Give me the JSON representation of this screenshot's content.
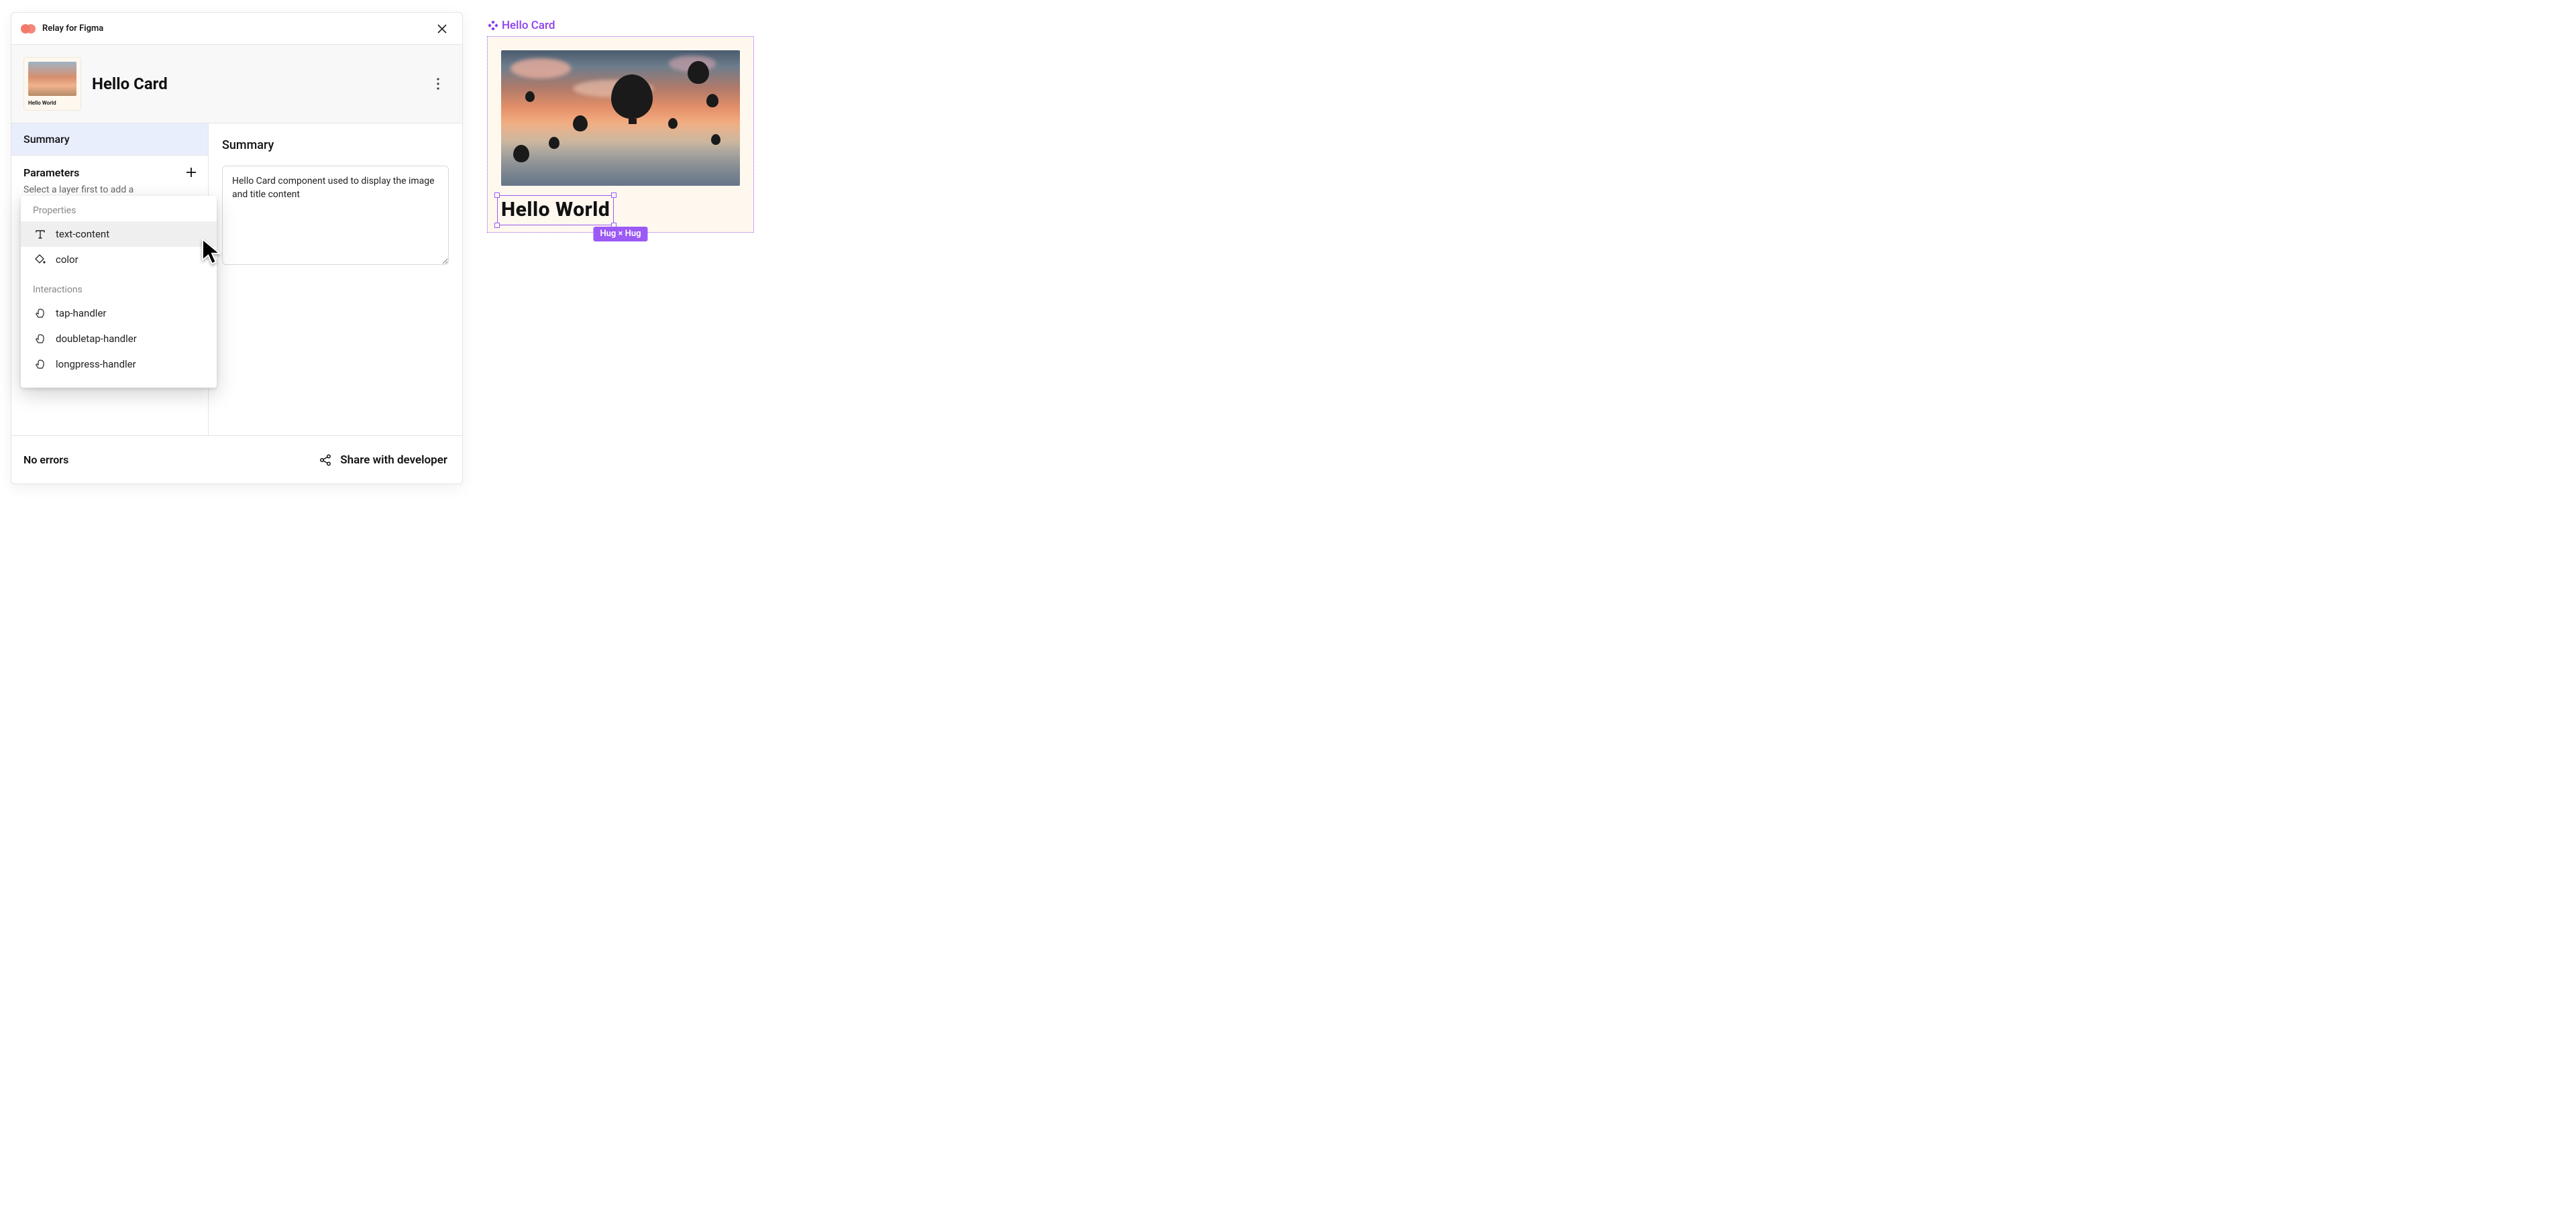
{
  "plugin": {
    "title": "Relay for Figma"
  },
  "component": {
    "name": "Hello Card",
    "thumbnail_label": "Hello World"
  },
  "sidebar": {
    "summary_tab": "Summary",
    "parameters_label": "Parameters",
    "parameters_hint": "Select a layer first to add a"
  },
  "main": {
    "heading": "Summary",
    "summary_text": "Hello Card component used to display the image and title content"
  },
  "popover": {
    "section_properties": "Properties",
    "section_interactions": "Interactions",
    "properties": [
      {
        "id": "text-content",
        "label": "text-content",
        "icon": "text-icon"
      },
      {
        "id": "color",
        "label": "color",
        "icon": "paint-bucket-icon"
      }
    ],
    "interactions": [
      {
        "id": "tap-handler",
        "label": "tap-handler",
        "icon": "tap-icon"
      },
      {
        "id": "doubletap-handler",
        "label": "doubletap-handler",
        "icon": "tap-icon"
      },
      {
        "id": "longpress-handler",
        "label": "longpress-handler",
        "icon": "tap-icon"
      }
    ]
  },
  "footer": {
    "status": "No errors",
    "share_label": "Share with developer"
  },
  "canvas": {
    "component_label": "Hello Card",
    "text_layer": "Hello World",
    "constraint_badge": "Hug × Hug"
  },
  "colors": {
    "figma_purple": "#9b59f5",
    "summary_tab_bg": "#e8eefc",
    "card_bg": "#fff8ef"
  }
}
